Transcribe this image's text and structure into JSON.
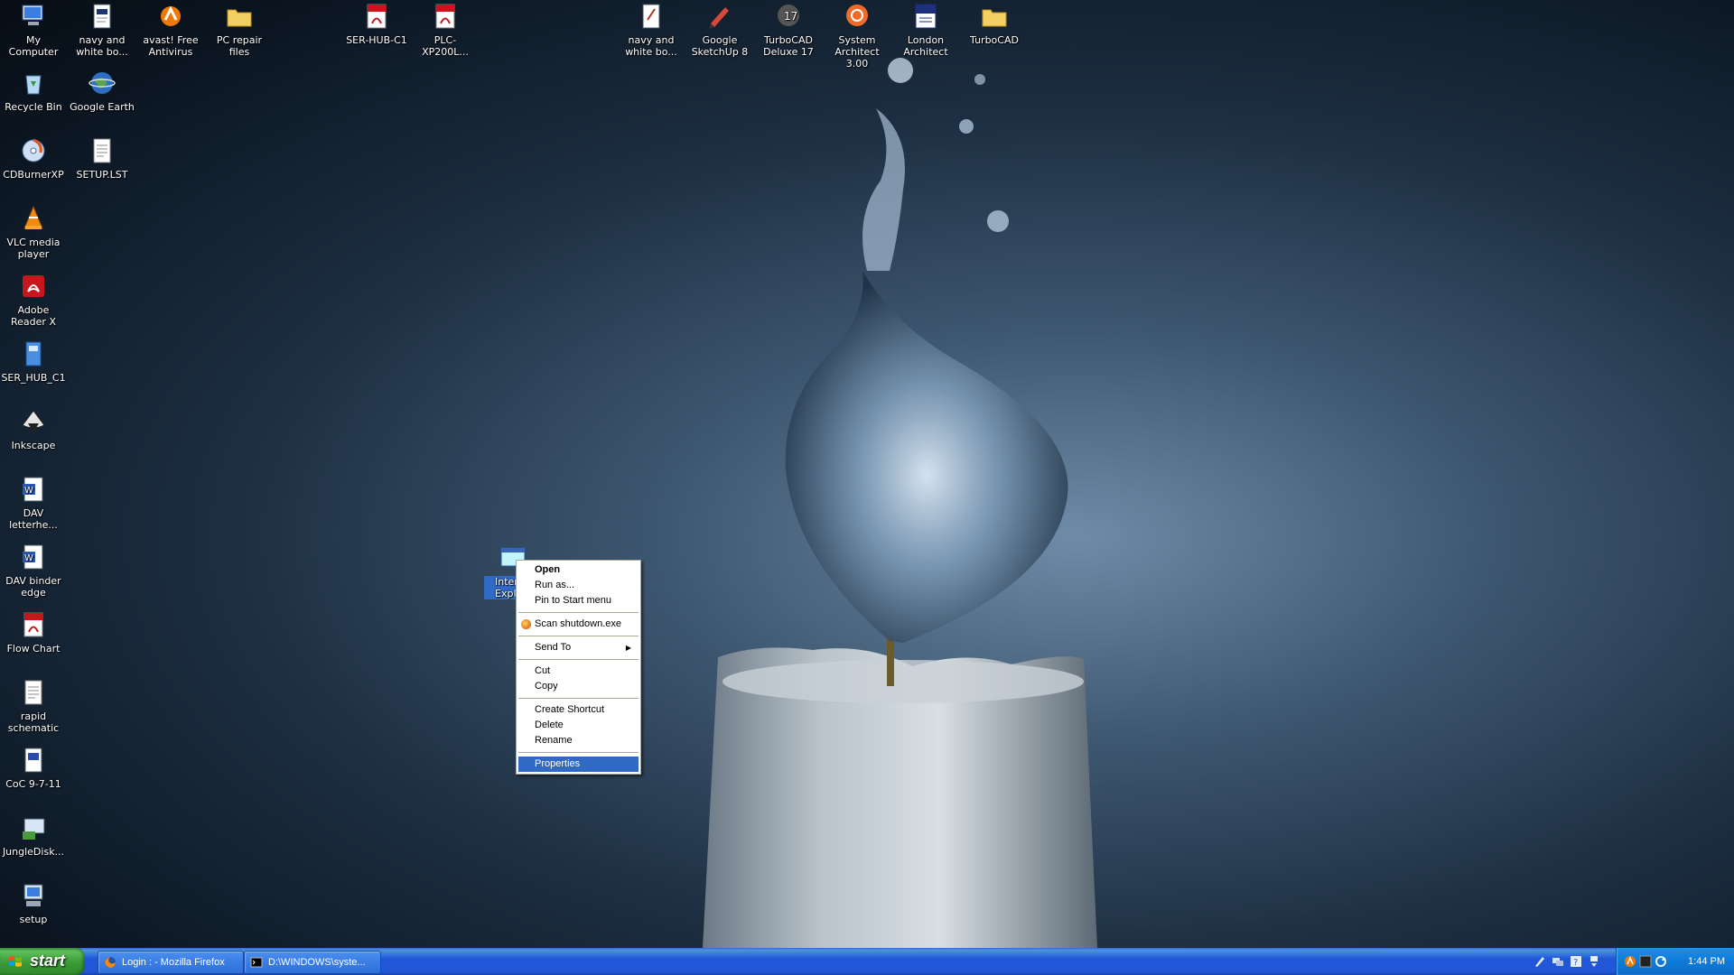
{
  "desktop": {
    "icons": [
      {
        "label": "My Computer",
        "icon": "computer-icon"
      },
      {
        "label": "navy and white bo...",
        "icon": "document-icon"
      },
      {
        "label": "avast! Free Antivirus",
        "icon": "avast-icon"
      },
      {
        "label": "PC repair files",
        "icon": "folder-icon"
      },
      {
        "label": "SER-HUB-C1",
        "icon": "pdf-icon"
      },
      {
        "label": "PLC-XP200L...",
        "icon": "pdf-icon"
      },
      {
        "label": "navy and white bo...",
        "icon": "document-icon"
      },
      {
        "label": "Google SketchUp 8",
        "icon": "sketchup-icon"
      },
      {
        "label": "TurboCAD Deluxe 17",
        "icon": "turbocad-icon"
      },
      {
        "label": "System Architect 3.00",
        "icon": "system-architect-icon"
      },
      {
        "label": "London Architect",
        "icon": "london-architect-icon"
      },
      {
        "label": "TurboCAD",
        "icon": "folder-icon"
      },
      {
        "label": "Recycle Bin",
        "icon": "recycle-bin-icon"
      },
      {
        "label": "Google Earth",
        "icon": "google-earth-icon"
      },
      {
        "label": "CDBurnerXP",
        "icon": "cdburner-icon"
      },
      {
        "label": "SETUP.LST",
        "icon": "text-file-icon"
      },
      {
        "label": "VLC media player",
        "icon": "vlc-icon"
      },
      {
        "label": "Adobe Reader X",
        "icon": "adobe-reader-icon"
      },
      {
        "label": "SER_HUB_C1",
        "icon": "application-icon"
      },
      {
        "label": "Inkscape",
        "icon": "inkscape-icon"
      },
      {
        "label": "DAV letterhe...",
        "icon": "word-doc-icon"
      },
      {
        "label": "DAV binder edge",
        "icon": "word-doc-icon"
      },
      {
        "label": "Flow Chart",
        "icon": "pdf-icon"
      },
      {
        "label": "rapid schematic",
        "icon": "text-file-icon"
      },
      {
        "label": "CoC 9-7-11",
        "icon": "document-icon"
      },
      {
        "label": "JungleDisk...",
        "icon": "jungledisk-icon"
      },
      {
        "label": "setup",
        "icon": "setup-icon"
      },
      {
        "label": "Inter Expl",
        "icon": "internet-explorer-icon"
      }
    ]
  },
  "context_menu": {
    "items": [
      {
        "label": "Open"
      },
      {
        "label": "Run as..."
      },
      {
        "label": "Pin to Start menu"
      },
      {
        "label": "Scan shutdown.exe"
      },
      {
        "label": "Send To"
      },
      {
        "label": "Cut"
      },
      {
        "label": "Copy"
      },
      {
        "label": "Create Shortcut"
      },
      {
        "label": "Delete"
      },
      {
        "label": "Rename"
      },
      {
        "label": "Properties"
      }
    ]
  },
  "taskbar": {
    "start_label": "start",
    "tasks": [
      {
        "label": "Login : - Mozilla Firefox",
        "icon": "firefox-icon"
      },
      {
        "label": "D:\\WINDOWS\\syste...",
        "icon": "command-prompt-icon"
      }
    ],
    "clock": "1:44 PM"
  },
  "colors": {
    "taskbar": "#2157d7",
    "start_button": "#3a9a36",
    "selection": "#316ac5",
    "tray": "#0f7bd9"
  }
}
